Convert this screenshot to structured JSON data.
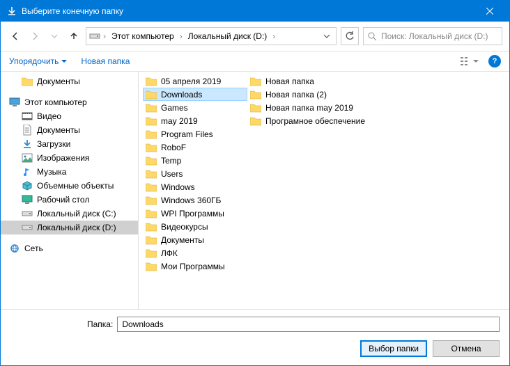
{
  "title": "Выберите конечную папку",
  "nav": {
    "path_segments": [
      "Этот компьютер",
      "Локальный диск (D:)"
    ]
  },
  "search": {
    "placeholder": "Поиск: Локальный диск (D:)"
  },
  "toolbar": {
    "organize": "Упорядочить",
    "new_folder": "Новая папка"
  },
  "tree": {
    "documents_top": "Документы",
    "this_pc": "Этот компьютер",
    "children": [
      {
        "label": "Видео",
        "icon": "video"
      },
      {
        "label": "Документы",
        "icon": "doc"
      },
      {
        "label": "Загрузки",
        "icon": "download"
      },
      {
        "label": "Изображения",
        "icon": "image"
      },
      {
        "label": "Музыка",
        "icon": "music"
      },
      {
        "label": "Объемные объекты",
        "icon": "cube"
      },
      {
        "label": "Рабочий стол",
        "icon": "desktop"
      },
      {
        "label": "Локальный диск (C:)",
        "icon": "drive"
      },
      {
        "label": "Локальный диск (D:)",
        "icon": "drive"
      }
    ],
    "network": "Сеть"
  },
  "files_col1": [
    "05 апреля 2019",
    "Downloads",
    "Games",
    "may 2019",
    "Program Files",
    "RoboF",
    "Temp",
    "Users",
    "Windows",
    "Windows 360ГБ",
    "WPI Программы",
    "Видеокурсы",
    "Документы",
    "ЛФК",
    "Мои Программы"
  ],
  "files_col2": [
    "Новая папка",
    "Новая папка (2)",
    "Новая папка may 2019",
    "Програмное обеспечение"
  ],
  "selected_file": "Downloads",
  "footer": {
    "folder_label": "Папка:",
    "folder_value": "Downloads",
    "select": "Выбор папки",
    "cancel": "Отмена"
  }
}
